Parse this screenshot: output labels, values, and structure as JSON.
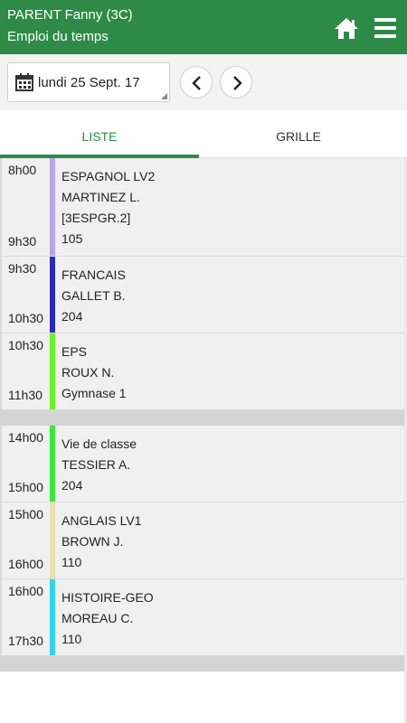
{
  "header": {
    "title": "PARENT Fanny (3C)",
    "subtitle": "Emploi du temps",
    "home_icon": "home-icon",
    "menu_icon": "menu-icon",
    "color": "#2e8b47"
  },
  "toolbar": {
    "date": "lundi 25 Sept. 17",
    "calendar_icon": "calendar-icon",
    "prev_icon": "chevron-left-icon",
    "next_icon": "chevron-right-icon"
  },
  "tabs": [
    {
      "label": "LISTE",
      "active": true
    },
    {
      "label": "GRILLE",
      "active": false
    }
  ],
  "courses": [
    {
      "start": "8h00",
      "end": "9h30",
      "color": "#b3a6e6",
      "lines": [
        "ESPAGNOL LV2",
        "MARTINEZ L.",
        "[3ESPGR.2]",
        "105"
      ]
    },
    {
      "start": "9h30",
      "end": "10h30",
      "color": "#2b2bb5",
      "lines": [
        "FRANCAIS",
        "GALLET B.",
        "204"
      ]
    },
    {
      "start": "10h30",
      "end": "11h30",
      "color": "#6cf02a",
      "lines": [
        "EPS",
        "ROUX N.",
        "Gymnase 1"
      ]
    },
    {
      "start": "14h00",
      "end": "15h00",
      "color": "#3ce83c",
      "lines": [
        "Vie de classe",
        "TESSIER A.",
        "204"
      ]
    },
    {
      "start": "15h00",
      "end": "16h00",
      "color": "#e5e2b0",
      "lines": [
        "ANGLAIS LV1",
        "BROWN J.",
        "110"
      ]
    },
    {
      "start": "16h00",
      "end": "17h30",
      "color": "#37d0f0",
      "lines": [
        "HISTOIRE-GEO",
        "MOREAU C.",
        "110"
      ]
    }
  ]
}
